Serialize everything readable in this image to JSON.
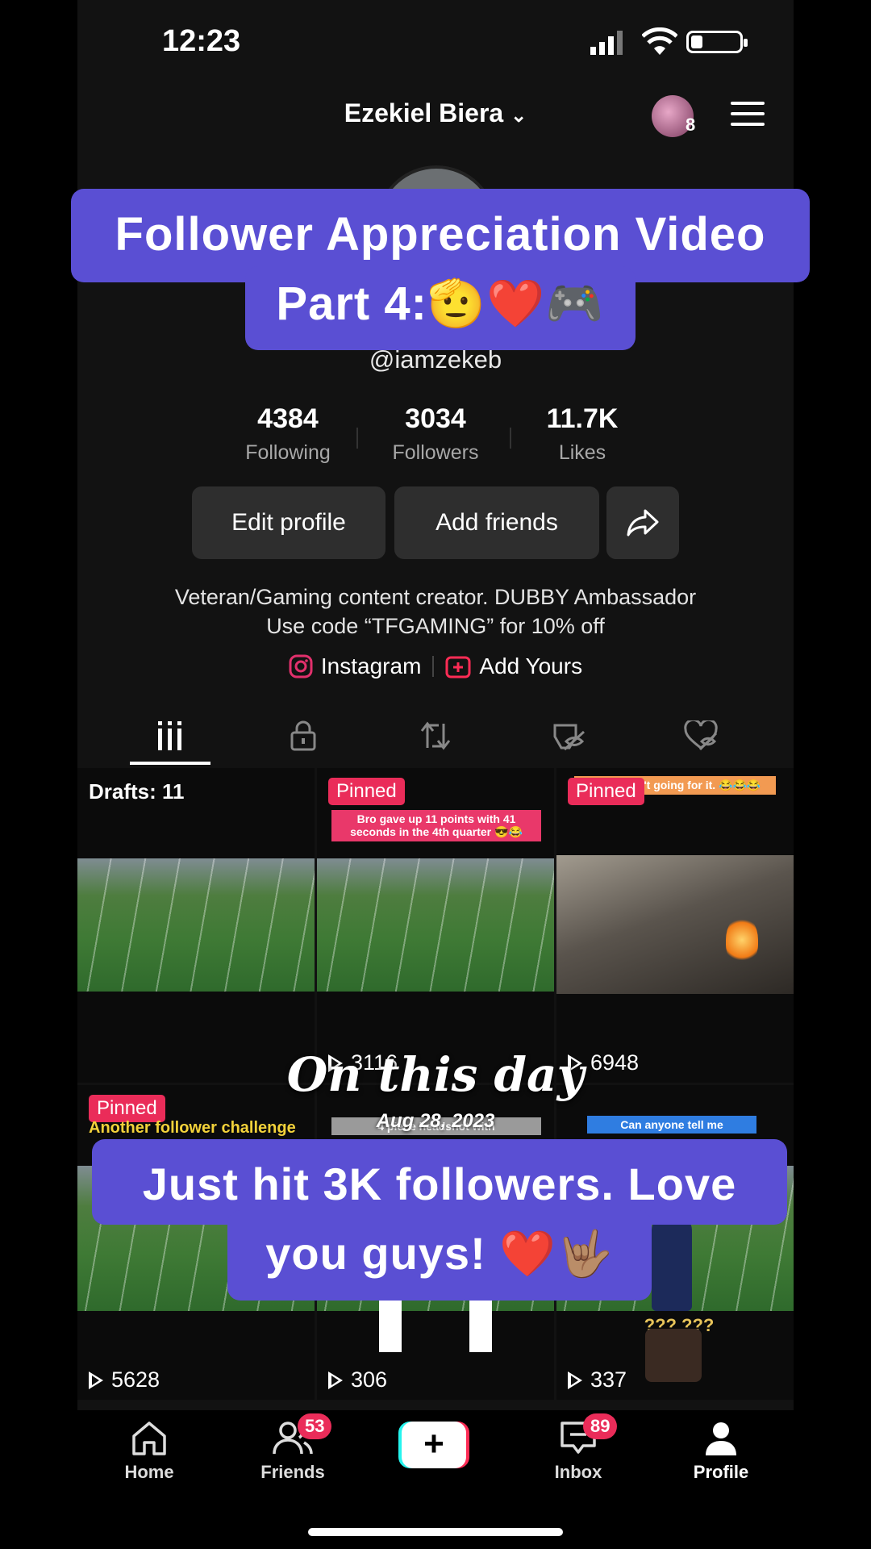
{
  "status": {
    "time": "12:23"
  },
  "header": {
    "username": "Ezekiel Biera",
    "notif_count": "8"
  },
  "overlay_top": {
    "line1": "Follower Appreciation Video",
    "line2": "Part 4:🫡❤️🎮"
  },
  "profile": {
    "handle": "@iamzekeb",
    "stats": [
      {
        "value": "4384",
        "label": "Following"
      },
      {
        "value": "3034",
        "label": "Followers"
      },
      {
        "value": "11.7K",
        "label": "Likes"
      }
    ],
    "edit_label": "Edit profile",
    "add_friends_label": "Add friends",
    "bio_line1": "Veteran/Gaming content creator. DUBBY Ambassador",
    "bio_line2": "Use code “TFGAMING” for 10% off",
    "instagram_label": "Instagram",
    "add_yours_label": "Add Yours"
  },
  "tabs": [
    "videos-icon",
    "lock-icon",
    "repost-icon",
    "eye-off-icon",
    "heart-off-icon"
  ],
  "grid": {
    "drafts_label": "Drafts: 11",
    "pinned_label": "Pinned",
    "caption_1": "Bro gave up 11 points with 41 seconds in the 4th quarter 😎😂",
    "caption_2": "hate wasn't going for it. 😂😂😂",
    "caption_3": "Another follower challenge",
    "caption_4": "4 piece headshot with",
    "caption_5": "Can anyone tell me",
    "caption_6": "??? ???",
    "views": [
      "3116",
      "6948",
      "5628",
      "306",
      "337"
    ]
  },
  "memory": {
    "title": "On this day",
    "date": "Aug 28, 2023"
  },
  "overlay_bottom": {
    "line1": "Just hit 3K followers. Love",
    "line2": "you guys! ❤️🤟🏽"
  },
  "nav": {
    "home": "Home",
    "friends": "Friends",
    "friends_badge": "53",
    "inbox": "Inbox",
    "inbox_badge": "89",
    "profile": "Profile"
  },
  "colors": {
    "accent": "#ea2c59",
    "overlay": "#5a4fd3",
    "background": "#121212"
  }
}
